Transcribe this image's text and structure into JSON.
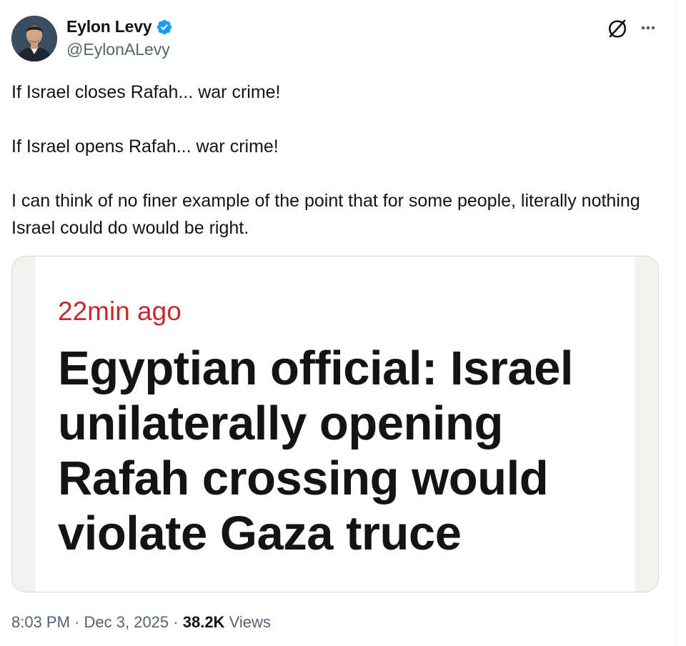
{
  "author": {
    "display_name": "Eylon Levy",
    "handle": "@EylonALevy",
    "verified_icon": "verified-badge-icon"
  },
  "icons": {
    "grok": "grok-icon",
    "more": "more-options-icon",
    "avatar": "profile-photo"
  },
  "tweet": {
    "line1": "If Israel closes Rafah... war crime!",
    "line2": "If Israel opens Rafah... war crime!",
    "line3": "I can think of no finer example of the point that for some people, literally nothing Israel could do would be right."
  },
  "media": {
    "time_ago": "22min ago",
    "headline": "Egyptian official: Israel unilaterally opening Rafah crossing would violate Gaza truce"
  },
  "meta": {
    "time": "8:03 PM",
    "separator": "·",
    "date": "Dec 3, 2025",
    "views_count": "38.2K",
    "views_label": "Views"
  },
  "colors": {
    "verified_blue": "#1d9bf0",
    "secondary_text": "#536471",
    "news_red": "#c8282e",
    "card_border": "#cfd9de"
  }
}
